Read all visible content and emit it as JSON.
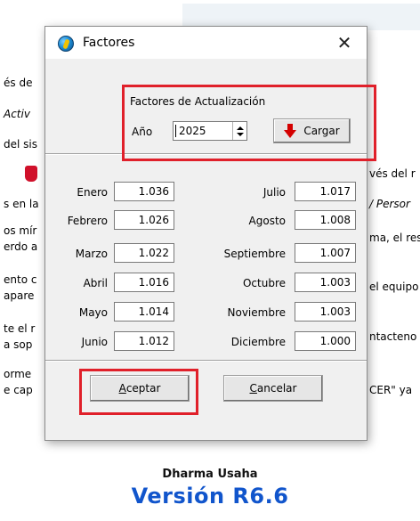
{
  "background": {
    "fragments_left": [
      "és de",
      "Activ",
      "del sis",
      "",
      "s en la",
      "os mír",
      "erdo a",
      "ento c",
      "apare",
      "te el r",
      "a sop",
      "orme",
      "e cap"
    ],
    "fragments_right": [
      "vés del r",
      "/ Persor",
      "ma, el res",
      "el equipo",
      "ntacteno",
      "CER\" ya"
    ],
    "company": "Dharma Usaha",
    "version": "Versión R6.6"
  },
  "dialog": {
    "title": "Factores",
    "close_glyph": "✕",
    "group_label": "Factores de Actualización",
    "year_label": "Año",
    "year_value": "2025",
    "load_button": "Cargar",
    "months": [
      {
        "name": "Enero",
        "value": "1.036"
      },
      {
        "name": "Febrero",
        "value": "1.026"
      },
      {
        "name": "Marzo",
        "value": "1.022"
      },
      {
        "name": "Abril",
        "value": "1.016"
      },
      {
        "name": "Mayo",
        "value": "1.014"
      },
      {
        "name": "Junio",
        "value": "1.012"
      },
      {
        "name": "Julio",
        "value": "1.017"
      },
      {
        "name": "Agosto",
        "value": "1.008"
      },
      {
        "name": "Septiembre",
        "value": "1.007"
      },
      {
        "name": "Octubre",
        "value": "1.003"
      },
      {
        "name": "Noviembre",
        "value": "1.003"
      },
      {
        "name": "Diciembre",
        "value": "1.000"
      }
    ],
    "accept_button": {
      "accel": "A",
      "rest": "ceptar"
    },
    "cancel_button": {
      "accel": "C",
      "rest": "ancelar"
    }
  },
  "colors": {
    "highlight": "#e0202a",
    "version_blue": "#1155cc"
  }
}
